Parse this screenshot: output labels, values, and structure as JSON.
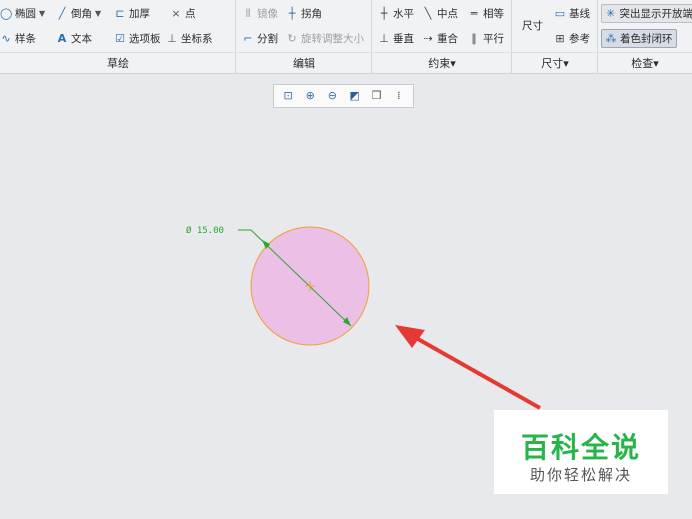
{
  "ribbon": {
    "sketch": {
      "ellipse": "椭圆",
      "chamfer": "倒角",
      "thicken": "加厚",
      "point": "点",
      "spline": "样条",
      "text": "文本",
      "palette": "选项板",
      "coord_system": "坐标系",
      "group_label": "草绘"
    },
    "edit": {
      "mirror": "镜像",
      "corner": "拐角",
      "divide": "分割",
      "rotate_resize": "旋转调整大小",
      "group_label": "编辑"
    },
    "constrain": {
      "horizontal": "水平",
      "midpoint": "中点",
      "equal": "相等",
      "vertical": "垂直",
      "coincident": "重合",
      "parallel": "平行",
      "group_label": "约束▾"
    },
    "dimension": {
      "dimension": "尺寸",
      "baseline": "基线",
      "reference": "参考",
      "group_label": "尺寸▾"
    },
    "inspect": {
      "highlight_open_ends": "突出显示开放端",
      "shade_closed_loops": "着色封闭环",
      "group_label": "检查▾"
    }
  },
  "canvas": {
    "dimension_label": "Ø 15.00",
    "circle_fill": "#ecbfe6",
    "circle_stroke": "#f0a030",
    "dimension_color": "#2aa82a",
    "arrow_color": "#e53a33"
  },
  "watermark": {
    "title": "百科全说",
    "subtitle": "助你轻松解决"
  }
}
